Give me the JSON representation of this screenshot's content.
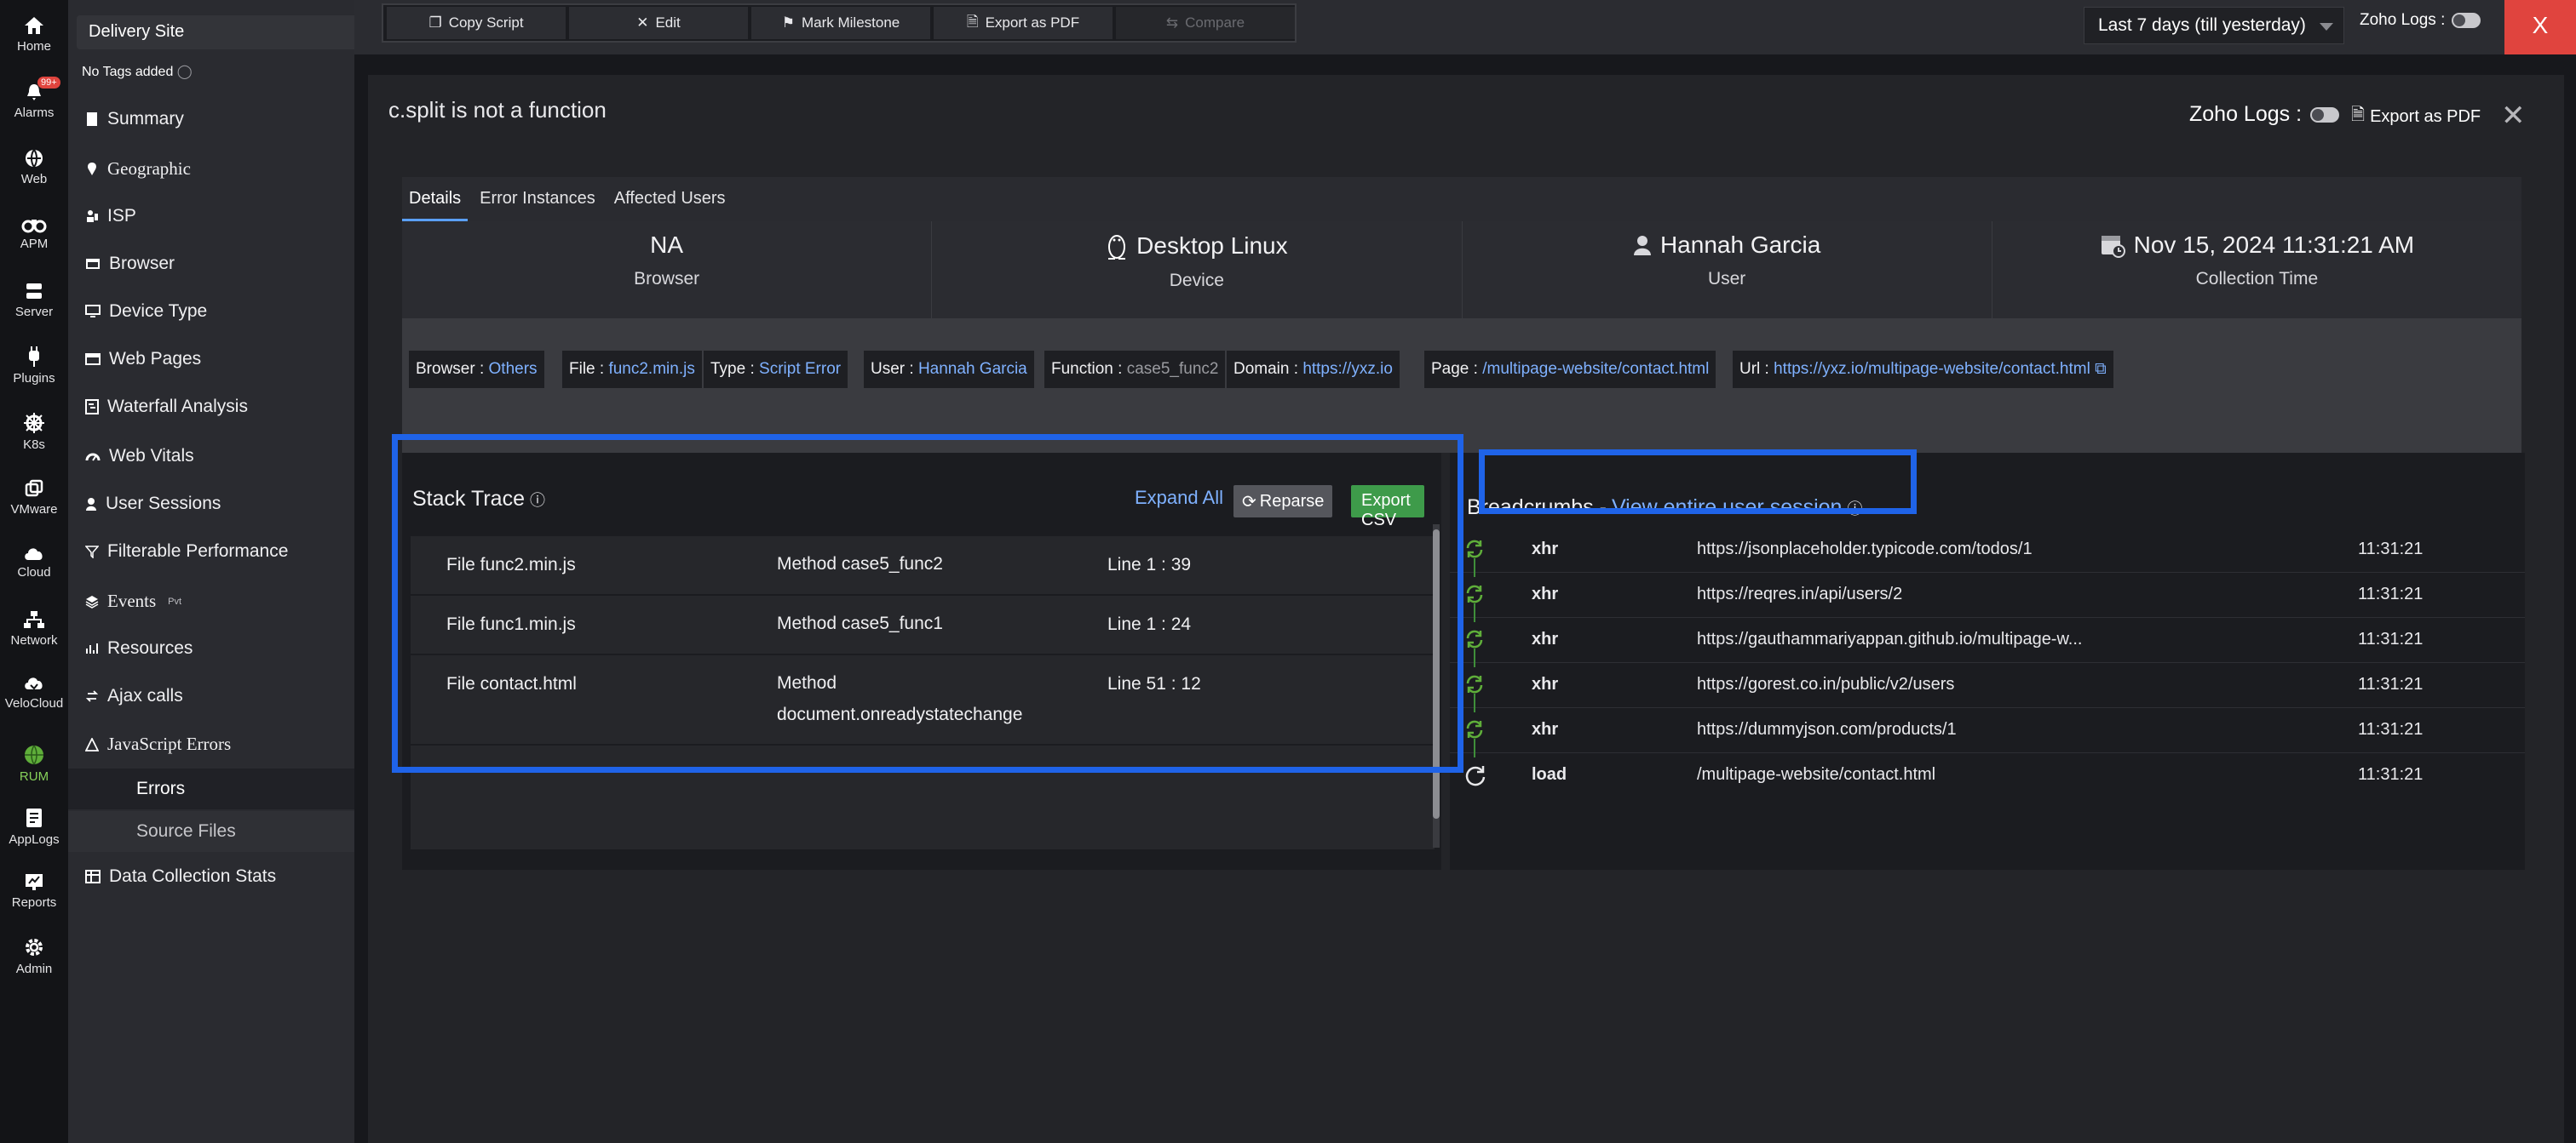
{
  "rail": [
    {
      "label": "Home",
      "icon": "home-icon"
    },
    {
      "label": "Alarms",
      "icon": "bell-icon",
      "badge": "99+"
    },
    {
      "label": "Web",
      "icon": "globe-icon"
    },
    {
      "label": "APM",
      "icon": "binoculars-icon"
    },
    {
      "label": "Server",
      "icon": "server-icon"
    },
    {
      "label": "Plugins",
      "icon": "plug-icon"
    },
    {
      "label": "K8s",
      "icon": "helm-icon"
    },
    {
      "label": "VMware",
      "icon": "vm-icon"
    },
    {
      "label": "Cloud",
      "icon": "cloud-icon"
    },
    {
      "label": "Network",
      "icon": "network-icon"
    },
    {
      "label": "VeloCloud",
      "icon": "velocloud-icon"
    },
    {
      "label": "RUM",
      "icon": "rum-globe-icon"
    },
    {
      "label": "AppLogs",
      "icon": "applogs-icon"
    },
    {
      "label": "Reports",
      "icon": "reports-icon"
    },
    {
      "label": "Admin",
      "icon": "gear-icon"
    }
  ],
  "sidebar": {
    "site": "Delivery Site",
    "no_tags": "No Tags added",
    "items": [
      "Summary",
      "Geographic",
      "ISP",
      "Browser",
      "Device Type",
      "Web Pages",
      "Waterfall Analysis",
      "Web Vitals",
      "User Sessions",
      "Filterable Performance",
      "Events",
      "Resources",
      "Ajax calls",
      "JavaScript Errors"
    ],
    "events_tag": "Pvt",
    "sub_items": [
      "Errors",
      "Source Files"
    ],
    "data_collection": "Data Collection Stats"
  },
  "toolbar": {
    "copy_script": "Copy Script",
    "edit": "Edit",
    "mark_milestone": "Mark Milestone",
    "export_pdf": "Export as PDF",
    "compare": "Compare"
  },
  "top": {
    "period": "Last 7 days (till yesterday)",
    "zoho_logs": "Zoho Logs :",
    "close": "X"
  },
  "panel": {
    "title": "c.split is not a function",
    "zoho_logs": "Zoho Logs :",
    "export_pdf": "Export as PDF"
  },
  "tabs": [
    "Details",
    "Error Instances",
    "Affected Users"
  ],
  "summary": [
    {
      "value": "NA",
      "label": "Browser"
    },
    {
      "value": "Desktop Linux",
      "label": "Device"
    },
    {
      "value": "Hannah Garcia",
      "label": "User"
    },
    {
      "value": "Nov 15, 2024 11:31:21 AM",
      "label": "Collection Time"
    }
  ],
  "chips": [
    {
      "k": "Browser : ",
      "v": "Others"
    },
    {
      "k": "File : ",
      "v": "func2.min.js"
    },
    {
      "k": "Type : ",
      "v": "Script Error"
    },
    {
      "k": "User : ",
      "v": "Hannah Garcia"
    },
    {
      "k": "Function : ",
      "v": "case5_func2"
    },
    {
      "k": "Domain : ",
      "v": "https://yxz.io"
    },
    {
      "k": "Page : ",
      "v": "/multipage-website/contact.html"
    },
    {
      "k": "Url : ",
      "v": "https://yxz.io/multipage-website/contact.html"
    }
  ],
  "stack": {
    "title": "Stack Trace",
    "expand_all": "Expand All",
    "reparse": "Reparse",
    "export_csv": "Export CSV",
    "rows": [
      {
        "file": "File  func2.min.js",
        "method": "Method  case5_func2",
        "line": "Line  1 : 39"
      },
      {
        "file": "File  func1.min.js",
        "method": "Method  case5_func1",
        "line": "Line  1 : 24"
      },
      {
        "file": "File  contact.html",
        "method": "Method  document.onreadystatechange",
        "line": "Line  51 : 12"
      }
    ]
  },
  "breadcrumbs": {
    "title": "Breadcrumbs - ",
    "link": "View entire user session",
    "rows": [
      {
        "type": "xhr",
        "url": "https://jsonplaceholder.typicode.com/todos/1",
        "time": "11:31:21"
      },
      {
        "type": "xhr",
        "url": "https://reqres.in/api/users/2",
        "time": "11:31:21"
      },
      {
        "type": "xhr",
        "url": "https://gauthammariyappan.github.io/multipage-w...",
        "time": "11:31:21"
      },
      {
        "type": "xhr",
        "url": "https://gorest.co.in/public/v2/users",
        "time": "11:31:21"
      },
      {
        "type": "xhr",
        "url": "https://dummyjson.com/products/1",
        "time": "11:31:21"
      },
      {
        "type": "load",
        "url": "/multipage-website/contact.html",
        "time": "11:31:21"
      }
    ]
  },
  "colors": {
    "accent": "#1f63e8",
    "link": "#7fb1ff",
    "export_green": "#3e9b4a",
    "close_red": "#e0443e"
  }
}
